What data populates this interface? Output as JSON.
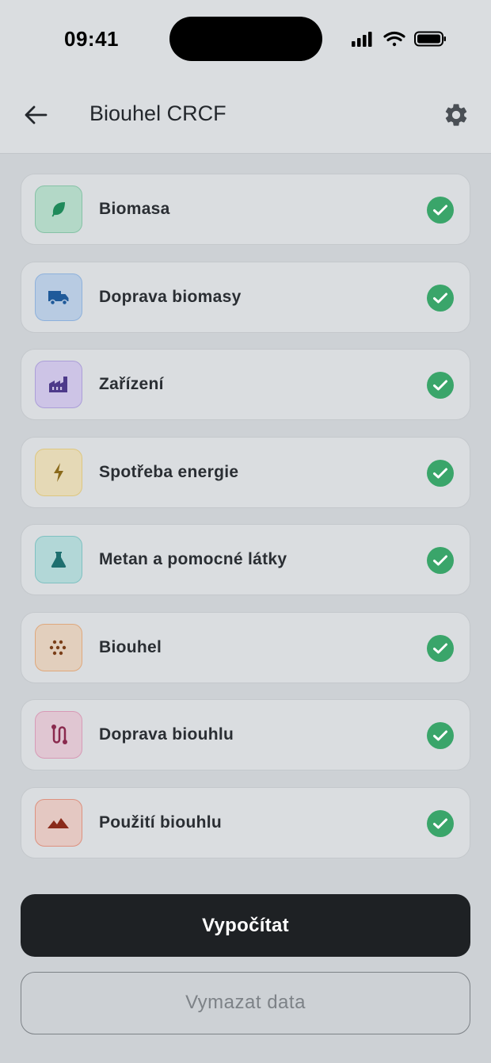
{
  "status_bar": {
    "time": "09:41"
  },
  "app_bar": {
    "title": "Biouhel CRCF"
  },
  "colors": {
    "check": "#3aa56a",
    "primary_button": "#1e2124"
  },
  "items": [
    {
      "label": "Biomasa",
      "icon": "leaf-icon",
      "completed": true,
      "tint": "#b3d8c7",
      "accent": "#1f8a5a"
    },
    {
      "label": "Doprava biomasy",
      "icon": "truck-icon",
      "completed": true,
      "tint": "#b8cbe2",
      "accent": "#1f5a9a"
    },
    {
      "label": "Zařízení",
      "icon": "factory-icon",
      "completed": true,
      "tint": "#cdc4e6",
      "accent": "#4d3a8a"
    },
    {
      "label": "Spotřeba energie",
      "icon": "lightning-icon",
      "completed": true,
      "tint": "#e5d9b6",
      "accent": "#8a6a1a"
    },
    {
      "label": "Metan a pomocné látky",
      "icon": "flask-icon",
      "completed": true,
      "tint": "#b2d7d7",
      "accent": "#1e6f6f"
    },
    {
      "label": "Biouhel",
      "icon": "dots-icon",
      "completed": true,
      "tint": "#e2cfbd",
      "accent": "#7a3e18"
    },
    {
      "label": "Doprava biouhlu",
      "icon": "route-icon",
      "completed": true,
      "tint": "#e0c6d2",
      "accent": "#8a2a4e"
    },
    {
      "label": "Použití biouhlu",
      "icon": "mountains-icon",
      "completed": true,
      "tint": "#e4c8c2",
      "accent": "#8a2a1a"
    }
  ],
  "actions": {
    "calculate": "Vypočítat",
    "clear": "Vymazat data"
  }
}
